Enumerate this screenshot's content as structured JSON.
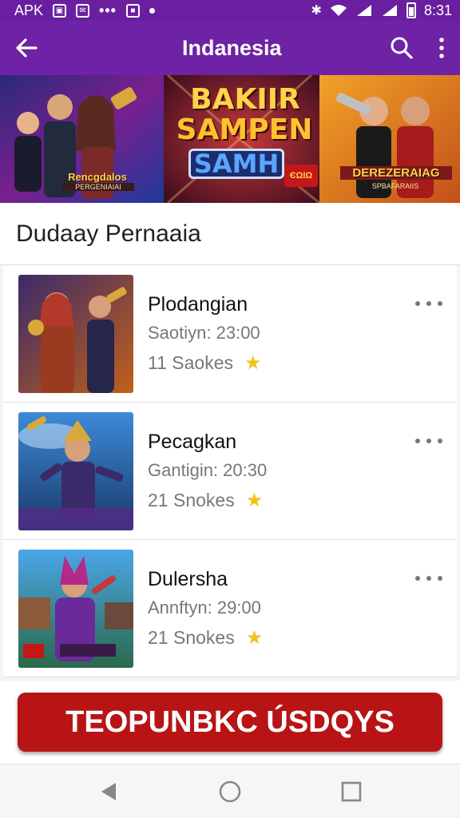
{
  "status_bar": {
    "left_label": "APK",
    "time": "8:31"
  },
  "app_bar": {
    "title": "Indanesia"
  },
  "banner": {
    "main_line1": "BAKIIR",
    "main_line2": "SAMPEN",
    "main_line3": "SAMH",
    "left_caption": "Rencgdalos",
    "left_subcaption": "PERGENIAIAI",
    "right_caption": "DEREZERAIAG",
    "right_subcaption": "SPBAFARAIIS",
    "badge": "ЄΩΙΩ"
  },
  "section": {
    "title": "Dudaay Pernaaia"
  },
  "items": [
    {
      "title": "Plodangian",
      "subtitle": "Saotiyn: 23:00",
      "count": "11 Saokes",
      "icon": "star-icon"
    },
    {
      "title": "Pecagkan",
      "subtitle": "Gantigin: 20:30",
      "count": "21 Snokes",
      "icon": "star-icon"
    },
    {
      "title": "Dulersha",
      "subtitle": "Annftyn: 29:00",
      "count": "21 Snokes",
      "icon": "star-icon"
    }
  ],
  "cta": {
    "label": "TEOPUNBKC ÚSDQYS"
  },
  "colors": {
    "primary": "#6e22a6",
    "cta": "#b81416",
    "star": "#f2c21b"
  }
}
